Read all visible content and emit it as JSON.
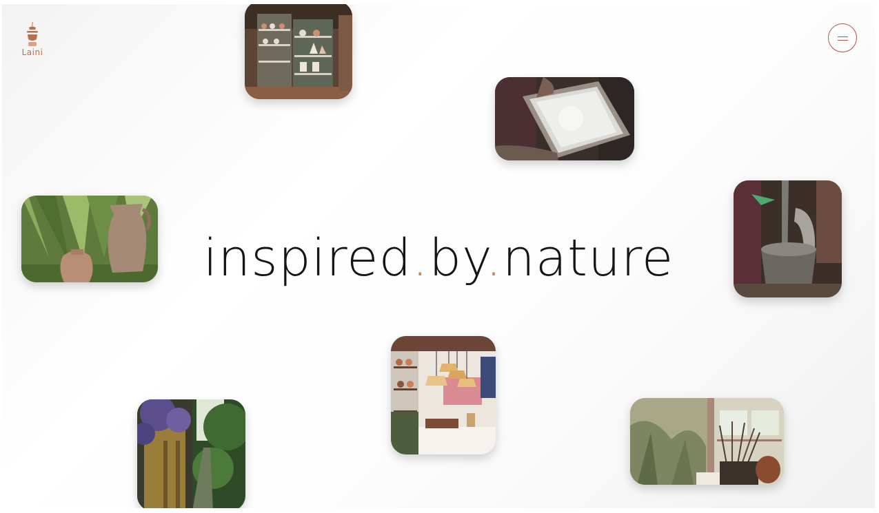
{
  "brand": {
    "name": "Laini",
    "color": "#b5714f"
  },
  "menu": {
    "icon": "hamburger-menu-icon",
    "color": "#a65a45"
  },
  "headline": {
    "word1": "inspired",
    "sep1": ".",
    "word2": "by",
    "sep2": ".",
    "word3": "nature",
    "accent_color": "#c58a6c"
  },
  "photos": [
    {
      "name": "pottery-shelves-photo"
    },
    {
      "name": "clay-sieve-photo"
    },
    {
      "name": "garden-pots-photo"
    },
    {
      "name": "clay-bucket-photo"
    },
    {
      "name": "pendant-lamps-photo"
    },
    {
      "name": "garden-path-photo"
    },
    {
      "name": "paint-brushes-photo"
    }
  ]
}
